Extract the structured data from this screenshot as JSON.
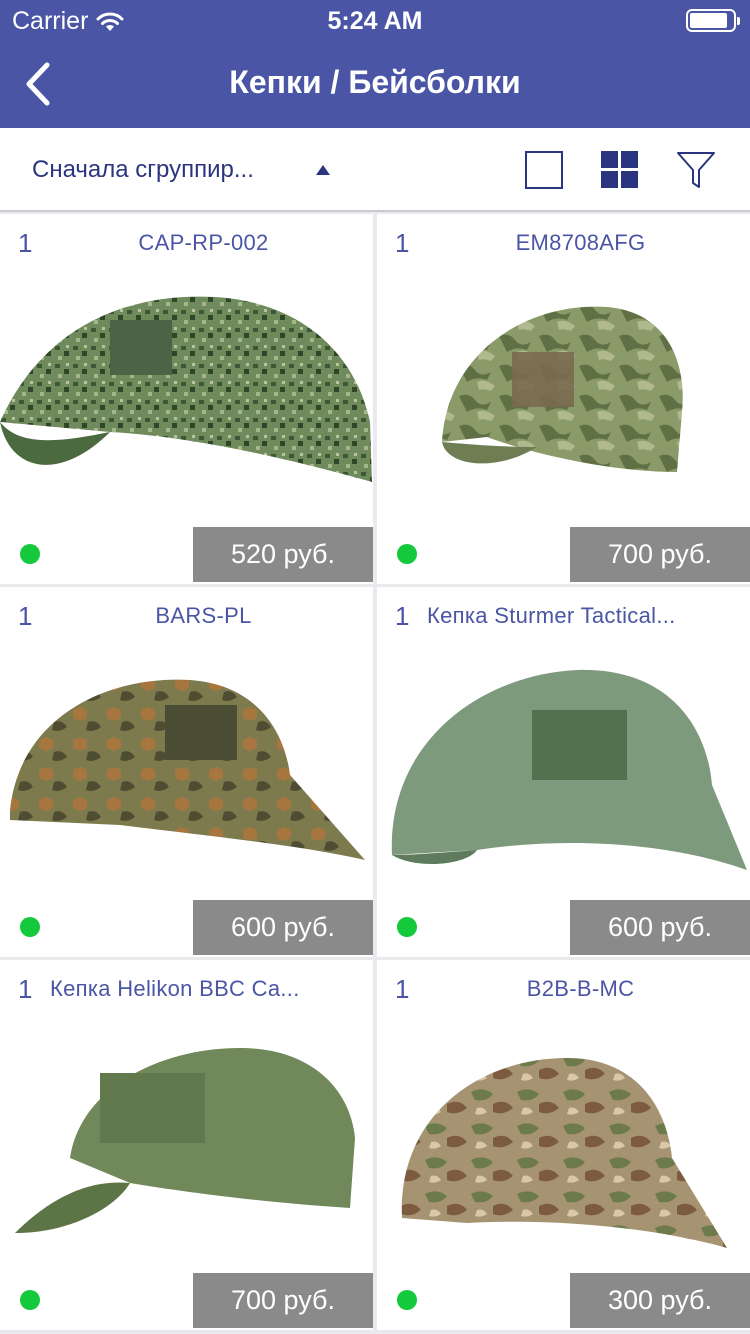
{
  "status_bar": {
    "carrier": "Carrier",
    "time": "5:24 AM"
  },
  "nav": {
    "title": "Кепки / Бейсболки",
    "back_icon": "chevron-left-icon"
  },
  "toolbar": {
    "sort_label": "Сначала сгруппир...",
    "icons": [
      "sort-arrow-up-icon",
      "single-view-icon",
      "grid-view-icon",
      "filter-icon"
    ]
  },
  "colors": {
    "brand": "#4a56a5",
    "label": "#2b357f",
    "in_stock": "#14c93b",
    "price_bg": "#8a8a8a"
  },
  "products": [
    {
      "qty": "1",
      "name": "CAP-RP-002",
      "price": "520 руб."
    },
    {
      "qty": "1",
      "name": "EM8708AFG",
      "price": "700 руб."
    },
    {
      "qty": "1",
      "name": "BARS-PL",
      "price": "600 руб."
    },
    {
      "qty": "1",
      "name": "Кепка Sturmer Tactical...",
      "price": "600 руб."
    },
    {
      "qty": "1",
      "name": "Кепка Helikon BBC Ca...",
      "price": "700 руб."
    },
    {
      "qty": "1",
      "name": "B2B-B-MC",
      "price": "300 руб."
    }
  ]
}
